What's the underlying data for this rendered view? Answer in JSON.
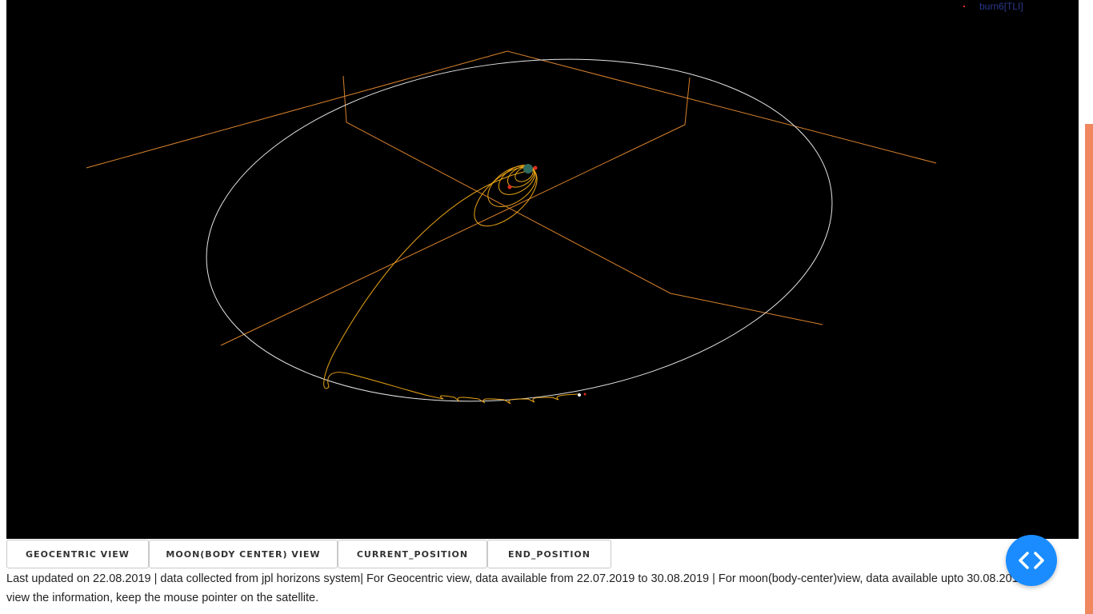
{
  "legend": {
    "item_label": "burn6[TLI]",
    "item_color": "#e0301e"
  },
  "colors": {
    "moon_orbit": "#e6e6e6",
    "trajectory": "#e8a317",
    "axis_lines": "#d9822b",
    "earth": "#2e6b5e",
    "marker": "#e0301e",
    "scroll_thumb": "#f0875f",
    "fab": "#1a8cff"
  },
  "buttons": {
    "geocentric": "GEOCENTRIC VIEW",
    "moon": "MOON(BODY CENTER) VIEW",
    "current": "CURRENT_POSITION",
    "end": "END_POSITION"
  },
  "info": {
    "text": "Last updated on 22.08.2019 | data collected from jpl horizons system| For Geocentric view, data available from 22.07.2019 to 30.08.2019 | For moon(body-center)view, data available upto 30.08.2019 | To view the information, keep the mouse pointer on the satellite."
  },
  "fab": {
    "icon": "code-brackets-icon"
  }
}
